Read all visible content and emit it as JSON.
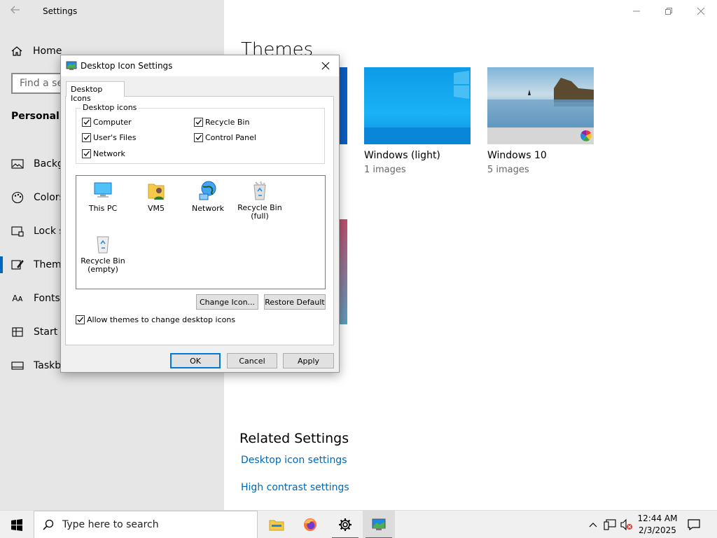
{
  "settings": {
    "title": "Settings",
    "home_label": "Home",
    "search_placeholder": "Find a setting",
    "section_title": "Personalization",
    "nav": [
      {
        "label": "Background",
        "icon": "picture-icon"
      },
      {
        "label": "Colors",
        "icon": "palette-icon"
      },
      {
        "label": "Lock screen",
        "icon": "lock-screen-icon"
      },
      {
        "label": "Themes",
        "icon": "themes-icon",
        "active": true
      },
      {
        "label": "Fonts",
        "icon": "fonts-icon"
      },
      {
        "label": "Start",
        "icon": "start-icon"
      },
      {
        "label": "Taskbar",
        "icon": "taskbar-icon"
      }
    ]
  },
  "themes": {
    "title": "Themes",
    "cards": [
      {
        "name": "Windows (light)",
        "count": "1 images"
      },
      {
        "name": "Windows 10",
        "count": "5 images"
      }
    ]
  },
  "related": {
    "title": "Related Settings",
    "links": [
      "Desktop icon settings",
      "High contrast settings"
    ]
  },
  "dialog": {
    "title": "Desktop Icon Settings",
    "tab": "Desktop Icons",
    "group_label": "Desktop icons",
    "checkboxes": [
      {
        "label": "Computer",
        "checked": true
      },
      {
        "label": "Recycle Bin",
        "checked": true
      },
      {
        "label": "User's Files",
        "checked": true
      },
      {
        "label": "Control Panel",
        "checked": true
      },
      {
        "label": "Network",
        "checked": true
      }
    ],
    "icons": [
      {
        "label": "This PC"
      },
      {
        "label": "VM5"
      },
      {
        "label": "Network"
      },
      {
        "label": "Recycle Bin\n(full)"
      },
      {
        "label": "Recycle Bin\n(empty)"
      }
    ],
    "change_icon": "Change Icon...",
    "restore_default": "Restore Default",
    "allow_themes": "Allow themes to change desktop icons",
    "allow_themes_checked": true,
    "ok": "OK",
    "cancel": "Cancel",
    "apply": "Apply"
  },
  "taskbar": {
    "search_placeholder": "Type here to search",
    "time": "12:44 AM",
    "date": "2/3/2025"
  },
  "colors": {
    "accent": "#0078d7",
    "link": "#0067b8"
  }
}
